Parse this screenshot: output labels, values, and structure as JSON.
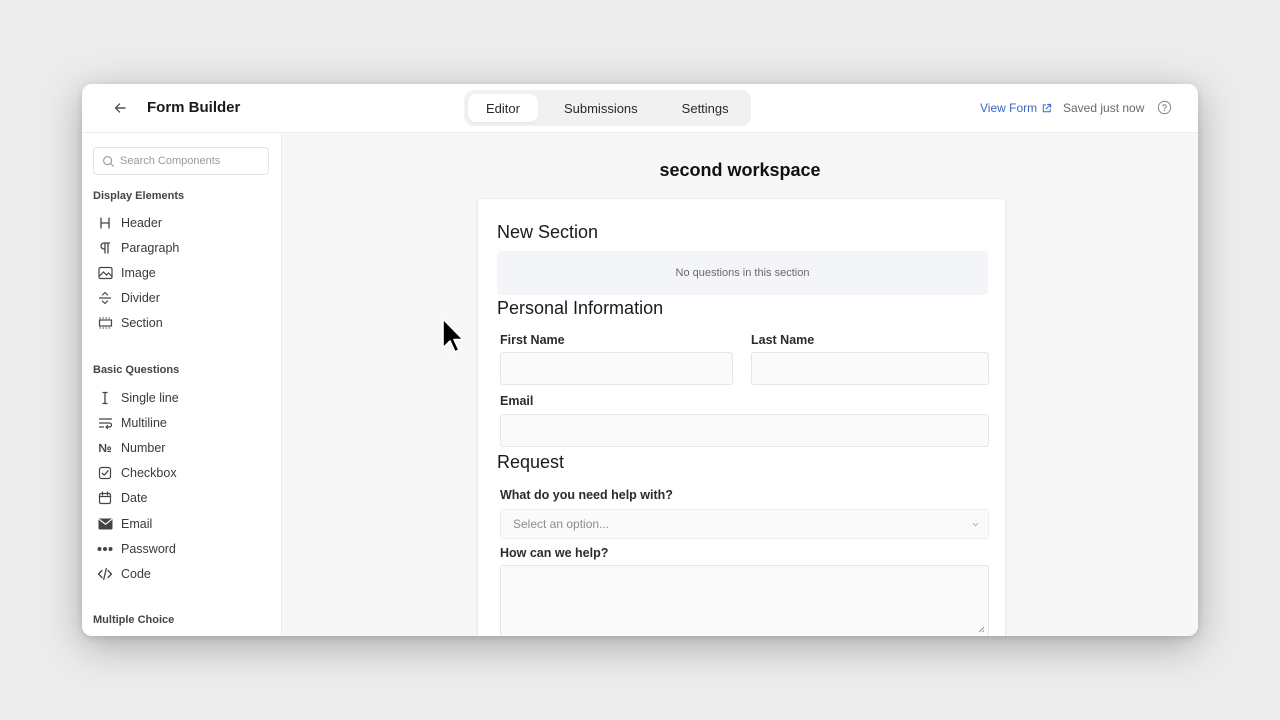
{
  "header": {
    "title": "Form Builder",
    "tabs": [
      {
        "label": "Editor",
        "active": true
      },
      {
        "label": "Submissions",
        "active": false
      },
      {
        "label": "Settings",
        "active": false
      }
    ],
    "view_form_label": "View Form",
    "save_status": "Saved just now"
  },
  "sidebar": {
    "search_placeholder": "Search Components",
    "groups": [
      {
        "title": "Display Elements",
        "items": [
          {
            "label": "Header",
            "icon": "heading-icon"
          },
          {
            "label": "Paragraph",
            "icon": "pilcrow-icon"
          },
          {
            "label": "Image",
            "icon": "image-icon"
          },
          {
            "label": "Divider",
            "icon": "divider-icon"
          },
          {
            "label": "Section",
            "icon": "section-icon"
          }
        ]
      },
      {
        "title": "Basic Questions",
        "items": [
          {
            "label": "Single line",
            "icon": "text-cursor-icon"
          },
          {
            "label": "Multiline",
            "icon": "wrap-text-icon"
          },
          {
            "label": "Number",
            "icon": "numero-icon"
          },
          {
            "label": "Checkbox",
            "icon": "checkbox-icon"
          },
          {
            "label": "Date",
            "icon": "calendar-icon"
          },
          {
            "label": "Email",
            "icon": "mail-icon"
          },
          {
            "label": "Password",
            "icon": "password-dots-icon"
          },
          {
            "label": "Code",
            "icon": "code-icon"
          }
        ]
      },
      {
        "title": "Multiple Choice",
        "items": []
      }
    ]
  },
  "canvas": {
    "workspace_title": "second workspace",
    "sections": [
      {
        "title": "New Section",
        "empty_text": "No questions in this section"
      },
      {
        "title": "Personal Information"
      },
      {
        "title": "Request"
      }
    ],
    "fields": {
      "first_name": {
        "label": "First Name",
        "value": ""
      },
      "last_name": {
        "label": "Last Name",
        "value": ""
      },
      "email": {
        "label": "Email",
        "value": ""
      },
      "help_topic": {
        "label": "What do you need help with?",
        "placeholder": "Select an option..."
      },
      "help_details": {
        "label": "How can we help?",
        "value": ""
      }
    }
  },
  "colors": {
    "accent": "#3a66c8",
    "canvas_bg": "#f7f7f7",
    "empty_section_bg": "#f3f5f8"
  }
}
